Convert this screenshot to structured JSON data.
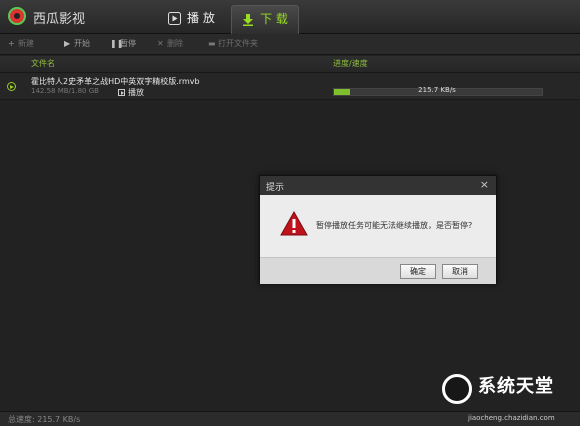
{
  "app": {
    "title": "西瓜影视"
  },
  "tabs": {
    "play": "播 放",
    "download": "下 载"
  },
  "toolbar": {
    "new": "新建",
    "start": "开始",
    "pause": "暂停",
    "delete": "删除",
    "open_folder": "打开文件夹"
  },
  "columns": {
    "filename": "文件名",
    "progress_speed": "进度/速度"
  },
  "task": {
    "filename": "霍比特人2史矛革之战HD中英双字精校版.rmvb",
    "size": "142.58 MB/1.80 GB",
    "play_label": "播放",
    "speed": "215.7 KB/s",
    "progress_fraction": 0.077
  },
  "dialog": {
    "title": "提示",
    "close": "×",
    "message": "暂停播放任务可能无法继续播放，是否暂停?",
    "ok": "确定",
    "cancel": "取消"
  },
  "status": {
    "total_speed": "总速度: 215.7 KB/s"
  },
  "watermark": {
    "title": "系统天堂",
    "url": "jiaocheng.chazidian.com"
  },
  "colors": {
    "accent": "#8fbf3f",
    "progress": "#7fbf2e",
    "warning": "#c0121b"
  }
}
